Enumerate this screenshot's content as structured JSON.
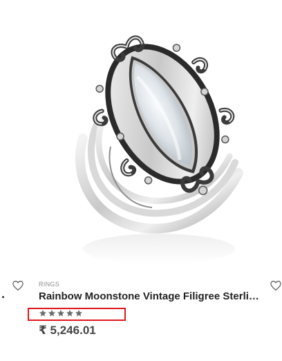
{
  "product": {
    "category": "RINGS",
    "title": "Rainbow Moonstone Vintage Filigree Sterli…",
    "price": "₹ 5,246.01",
    "rating_stars": 5
  },
  "icons": {
    "wishlist_left": "heart-outline-icon",
    "wishlist_right": "heart-outline-icon",
    "star": "star-icon"
  },
  "colors": {
    "highlight_border": "#e2141c",
    "star": "#6b6b6b",
    "title": "#222222",
    "price": "#444444",
    "category": "#8a8a8a"
  }
}
